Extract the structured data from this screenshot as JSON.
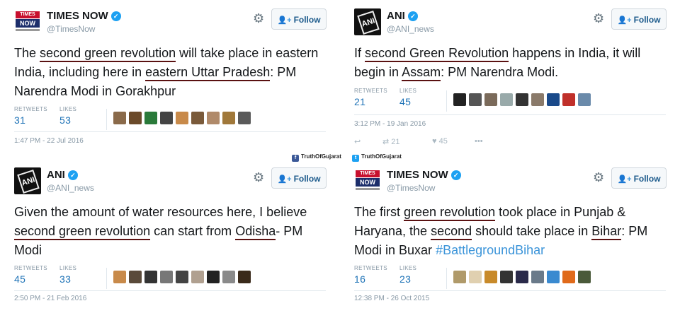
{
  "follow_label": "Follow",
  "follow_icon": "add-user-icon",
  "tweets": [
    {
      "account_name": "TIMES NOW",
      "handle": "@TimesNow",
      "text_segments": [
        {
          "t": "The ",
          "u": false
        },
        {
          "t": "second green revolution",
          "u": true
        },
        {
          "t": " will take place in eastern India, including here in ",
          "u": false
        },
        {
          "t": "eastern Uttar Pradesh",
          "u": true
        },
        {
          "t": ": PM Narendra Modi in Gorakhpur",
          "u": false
        }
      ],
      "retweets_label": "RETWEETS",
      "retweets": "31",
      "likes_label": "LIKES",
      "likes": "53",
      "timestamp": "1:47 PM - 22 Jul 2016"
    },
    {
      "account_name": "ANI",
      "handle": "@ANI_news",
      "text_segments": [
        {
          "t": "If ",
          "u": false
        },
        {
          "t": "second Green Revolution",
          "u": true
        },
        {
          "t": " happens in India, it will begin in ",
          "u": false
        },
        {
          "t": "Assam",
          "u": true
        },
        {
          "t": ": PM Narendra Modi.",
          "u": false
        }
      ],
      "retweets_label": "RETWEETS",
      "retweets": "21",
      "likes_label": "LIKES",
      "likes": "45",
      "timestamp": "3:12 PM - 19 Jan 2016",
      "action_retweets": "21",
      "action_likes": "45"
    },
    {
      "account_name": "ANI",
      "handle": "@ANI_news",
      "text_segments": [
        {
          "t": "Given the amount of water resources here, I believe ",
          "u": false
        },
        {
          "t": "second green revolution",
          "u": true
        },
        {
          "t": " can start from ",
          "u": false
        },
        {
          "t": "Odisha",
          "u": true
        },
        {
          "t": "- PM Modi",
          "u": false
        }
      ],
      "retweets_label": "RETWEETS",
      "retweets": "45",
      "likes_label": "LIKES",
      "likes": "33",
      "timestamp": "2:50 PM - 21 Feb 2016"
    },
    {
      "account_name": "TIMES NOW",
      "handle": "@TimesNow",
      "text_segments": [
        {
          "t": "The first ",
          "u": false
        },
        {
          "t": "green revolution",
          "u": true
        },
        {
          "t": " took place in Punjab & Haryana, the ",
          "u": false
        },
        {
          "t": "second",
          "u": true
        },
        {
          "t": " should take place in ",
          "u": false
        },
        {
          "t": "Bihar",
          "u": true
        },
        {
          "t": ": PM Modi in Buxar ",
          "u": false
        },
        {
          "t": "#BattlegroundBihar",
          "u": false,
          "hashtag": true
        }
      ],
      "retweets_label": "RETWEETS",
      "retweets": "16",
      "likes_label": "LIKES",
      "likes": "23",
      "timestamp": "12:38 PM - 26 Oct 2015"
    }
  ],
  "credit": {
    "facebook_icon": "facebook-icon",
    "facebook_label": "TruthOfGujarat",
    "twitter_icon": "twitter-icon",
    "twitter_label": "TruthOfGujarat"
  }
}
